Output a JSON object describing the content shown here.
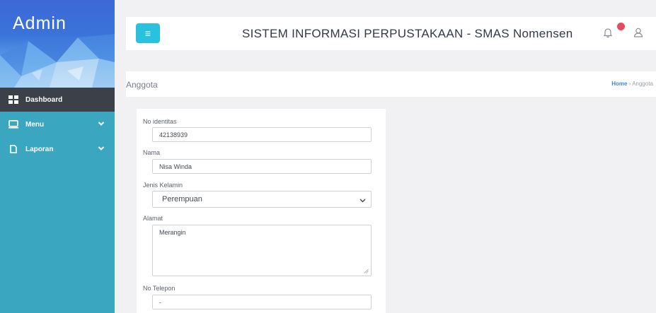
{
  "sidebar": {
    "brand": "Admin",
    "items": [
      {
        "label": "Dashboard",
        "icon": "grid-icon",
        "active": true
      },
      {
        "label": "Menu",
        "icon": "monitor-icon",
        "has_submenu": true
      },
      {
        "label": "Laporan",
        "icon": "document-icon",
        "has_submenu": true
      }
    ]
  },
  "header": {
    "title": "SISTEM INFORMASI PERPUSTAKAAN - SMAS Nomensen",
    "menu_icon": "hamburger-icon",
    "notifications_icon": "bell-icon",
    "user_icon": "user-icon"
  },
  "page": {
    "title": "Anggota",
    "breadcrumb": {
      "home": "Home",
      "separator": "›",
      "current": "Anggota"
    }
  },
  "form": {
    "no_identitas": {
      "label": "No identitas",
      "value": "42138939"
    },
    "nama": {
      "label": "Nama",
      "value": "Nisa Winda"
    },
    "jenis_kelamin": {
      "label": "Jenis Kelamin",
      "value": "Perempuan"
    },
    "alamat": {
      "label": "Alamat",
      "value": "Merangin"
    },
    "no_telepon": {
      "label": "No Telepon",
      "value": "-"
    }
  },
  "colors": {
    "sidebar": "#3aa6bf",
    "active_item": "#3b4049",
    "menu_button": "#29c2de",
    "badge": "#e74c5e",
    "link": "#3e87c9"
  }
}
